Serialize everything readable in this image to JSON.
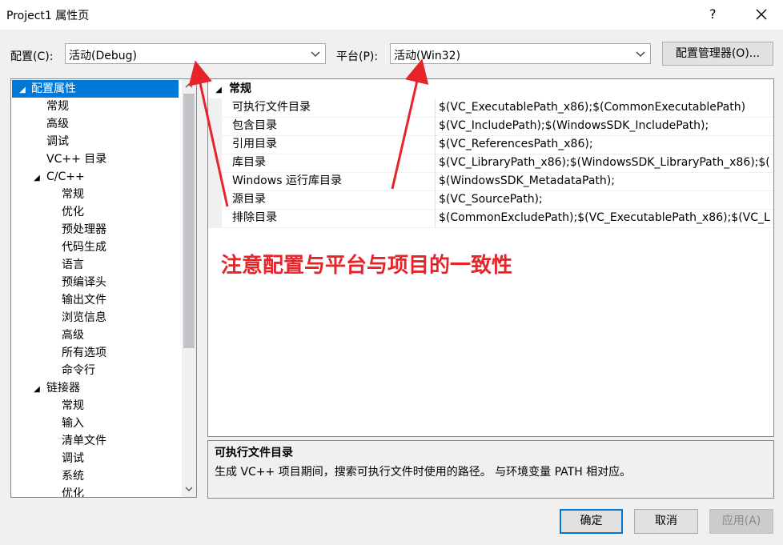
{
  "window": {
    "title": "Project1 属性页",
    "help": "?",
    "close": "close-icon"
  },
  "config": {
    "label": "配置(C):",
    "value": "活动(Debug)"
  },
  "platform": {
    "label": "平台(P):",
    "value": "活动(Win32)"
  },
  "config_manager_label": "配置管理器(O)...",
  "tree": {
    "items": [
      {
        "label": "配置属性",
        "toggle": "◢"
      },
      {
        "label": "常规"
      },
      {
        "label": "高级"
      },
      {
        "label": "调试"
      },
      {
        "label": "VC++ 目录"
      },
      {
        "label": "C/C++",
        "toggle": "◢"
      },
      {
        "label": "常规"
      },
      {
        "label": "优化"
      },
      {
        "label": "预处理器"
      },
      {
        "label": "代码生成"
      },
      {
        "label": "语言"
      },
      {
        "label": "预编译头"
      },
      {
        "label": "输出文件"
      },
      {
        "label": "浏览信息"
      },
      {
        "label": "高级"
      },
      {
        "label": "所有选项"
      },
      {
        "label": "命令行"
      },
      {
        "label": "链接器",
        "toggle": "◢"
      },
      {
        "label": "常规"
      },
      {
        "label": "输入"
      },
      {
        "label": "清单文件"
      },
      {
        "label": "调试"
      },
      {
        "label": "系统"
      },
      {
        "label": "优化"
      }
    ]
  },
  "grid": {
    "category": "常规",
    "rows": [
      {
        "name": "可执行文件目录",
        "value": "$(VC_ExecutablePath_x86);$(CommonExecutablePath)"
      },
      {
        "name": "包含目录",
        "value": "$(VC_IncludePath);$(WindowsSDK_IncludePath);"
      },
      {
        "name": "引用目录",
        "value": "$(VC_ReferencesPath_x86);"
      },
      {
        "name": "库目录",
        "value": "$(VC_LibraryPath_x86);$(WindowsSDK_LibraryPath_x86);$("
      },
      {
        "name": "Windows 运行库目录",
        "value": "$(WindowsSDK_MetadataPath);"
      },
      {
        "name": "源目录",
        "value": "$(VC_SourcePath);"
      },
      {
        "name": "排除目录",
        "value": "$(CommonExcludePath);$(VC_ExecutablePath_x86);$(VC_L"
      }
    ]
  },
  "annotation": "注意配置与平台与项目的一致性",
  "description": {
    "title": "可执行文件目录",
    "text": "生成 VC++ 项目期间，搜索可执行文件时使用的路径。 与环境变量 PATH 相对应。"
  },
  "buttons": {
    "ok": "确定",
    "cancel": "取消",
    "apply": "应用(A)"
  },
  "colors": {
    "accent": "#0078d7",
    "annotation": "#e8242b"
  }
}
